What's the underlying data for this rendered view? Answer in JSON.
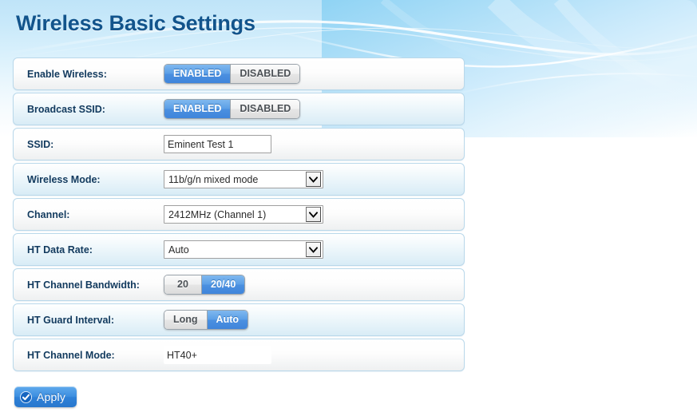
{
  "page": {
    "title": "Wireless Basic Settings",
    "accent_blue": "#4b90e0",
    "title_color": "#12548c",
    "banner_color": "#8fd3f4"
  },
  "rows": [
    {
      "label": "Enable Wireless:",
      "control": "toggle",
      "options": [
        "ENABLED",
        "DISABLED"
      ],
      "selected": "ENABLED"
    },
    {
      "label": "Broadcast SSID:",
      "control": "toggle",
      "options": [
        "ENABLED",
        "DISABLED"
      ],
      "selected": "ENABLED"
    },
    {
      "label": "SSID:",
      "control": "text",
      "value": "Eminent Test 1",
      "placeholder": ""
    },
    {
      "label": "Wireless Mode:",
      "control": "select",
      "value": "11b/g/n mixed mode"
    },
    {
      "label": "Channel:",
      "control": "select",
      "value": "2412MHz (Channel 1)"
    },
    {
      "label": "HT Data Rate:",
      "control": "select",
      "value": "Auto"
    },
    {
      "label": "HT Channel Bandwidth:",
      "control": "toggle",
      "options": [
        "20",
        "20/40"
      ],
      "selected": "20/40"
    },
    {
      "label": "HT Guard Interval:",
      "control": "toggle",
      "options": [
        "Long",
        "Auto"
      ],
      "selected": "Auto"
    },
    {
      "label": "HT Channel Mode:",
      "control": "text-flat",
      "value": "HT40+",
      "placeholder": ""
    }
  ],
  "apply": {
    "label": "Apply",
    "icon": "check-circle-icon"
  }
}
